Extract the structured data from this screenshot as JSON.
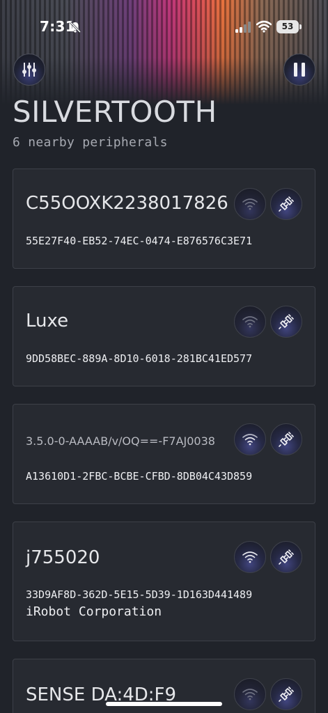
{
  "status_bar": {
    "time": "7:31",
    "battery": "53"
  },
  "header": {
    "title": "SILVERTOOTH",
    "subtitle": "6 nearby peripherals",
    "settings_icon": "sliders-icon",
    "pause_icon": "pause-icon"
  },
  "peripherals": [
    {
      "name": "C55OOXK2238017826",
      "uuid": "55E27F40-EB52-74EC-0474-E876576C3E71",
      "manufacturer": ""
    },
    {
      "name": "Luxe",
      "uuid": "9DD58BEC-889A-8D10-6018-281BC41ED577",
      "manufacturer": ""
    },
    {
      "name": "3.5.0-0-AAAAB/v/OQ==-F7AJ0038",
      "uuid": "A13610D1-2FBC-BCBE-CFBD-8DB04C43D859",
      "manufacturer": ""
    },
    {
      "name": "j755020",
      "uuid": "33D9AF8D-362D-5E15-5D39-1D163D441489",
      "manufacturer": "iRobot Corporation"
    },
    {
      "name": "SENSE DA:4D:F9",
      "uuid": "",
      "manufacturer": ""
    }
  ],
  "colors": {
    "background": "#20232a",
    "card": "#272a31",
    "card_border": "#3d4048",
    "button_glow": "#41457f"
  }
}
